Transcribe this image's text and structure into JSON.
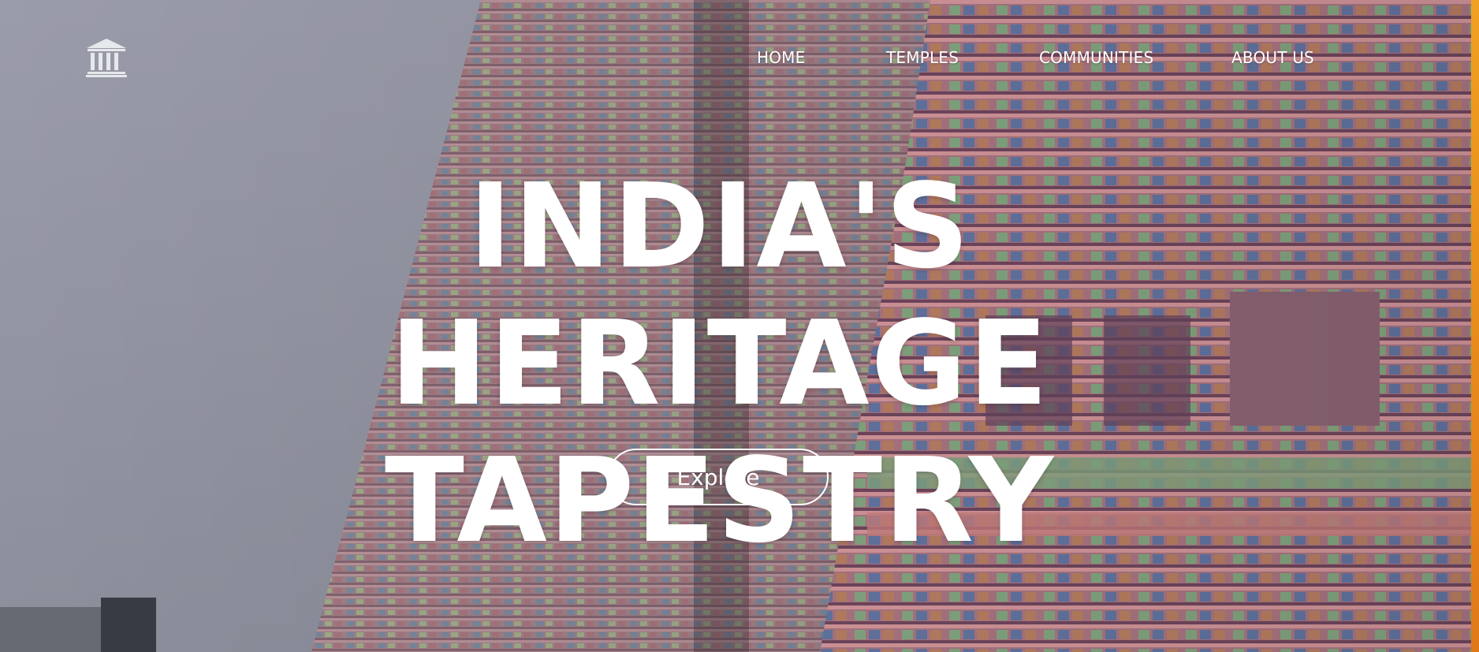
{
  "header": {
    "logo_icon": "temple-columns-icon",
    "nav": {
      "items": [
        {
          "label": "HOME"
        },
        {
          "label": "TEMPLES"
        },
        {
          "label": "COMMUNITIES"
        },
        {
          "label": "ABOUT US"
        }
      ]
    }
  },
  "hero": {
    "title_line1": "INDIA'S HERITAGE",
    "title_line2": "TAPESTRY",
    "button_label": "Explore",
    "background_image": "colorful-south-indian-temple-gopuram-photo"
  },
  "colors": {
    "text": "#ffffff",
    "sky": "#a6a8b4",
    "accent": "#f0a020"
  }
}
